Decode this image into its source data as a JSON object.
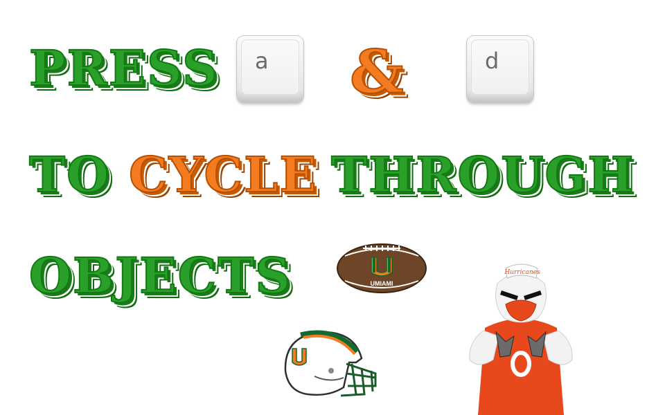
{
  "line1": {
    "word": "PRESS",
    "amp": "&"
  },
  "keys": {
    "first": "a",
    "second": "d"
  },
  "line2": {
    "w1": "TO",
    "w2": "CYCLE",
    "w3": "THROUGH"
  },
  "line3": {
    "w1": "OBJECTS"
  },
  "objects": [
    {
      "name": "football",
      "text": "UMIAMI"
    },
    {
      "name": "helmet"
    },
    {
      "name": "mascot",
      "text": "Hurricanes"
    }
  ],
  "colors": {
    "green": "#2aa02a",
    "orange": "#f47b20",
    "key": "#efefef"
  }
}
